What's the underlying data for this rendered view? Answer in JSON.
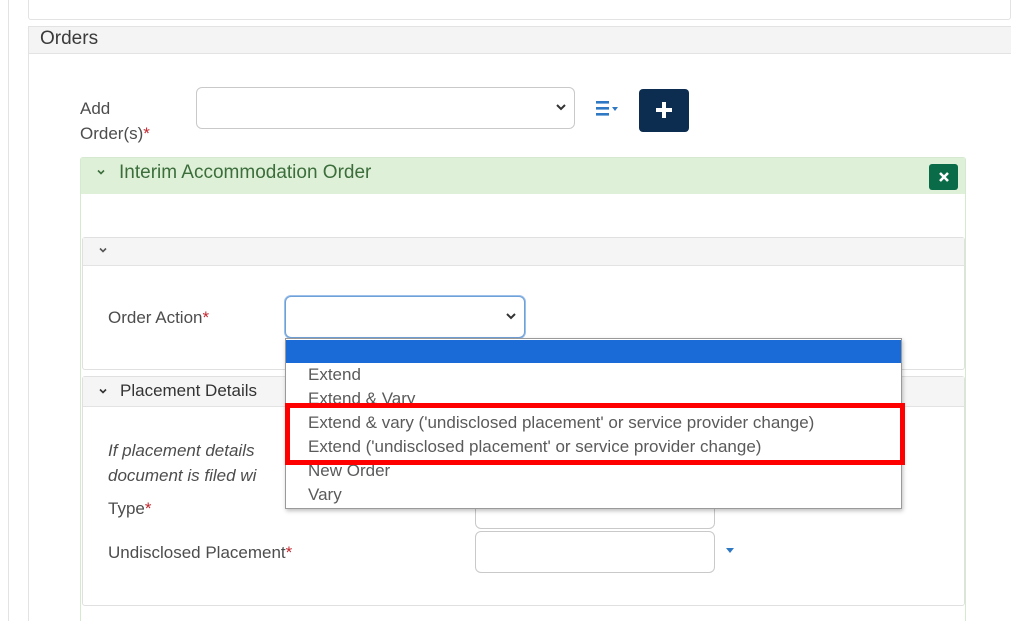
{
  "orders": {
    "title": "Orders",
    "add_label": "Add Order(s)",
    "required_mark": "*",
    "add_select_value": "",
    "add_button_icon": "plus-icon",
    "list_icon": "list-dropdown-icon"
  },
  "interim_order": {
    "title": "Interim Accommodation Order",
    "collapse_icon": "chevron-down-icon",
    "remove_icon": "close-icon"
  },
  "order_action": {
    "label": "Order Action",
    "value": "",
    "options": [
      "",
      "Extend",
      "Extend & Vary",
      "Extend & vary ('undisclosed placement' or service provider change)",
      "Extend ('undisclosed placement' or service provider change)",
      "New Order",
      "Vary"
    ],
    "selected_index": 0
  },
  "placement": {
    "title": "Placement Details",
    "info_line1": "If placement details",
    "info_line2": "document is filed wi",
    "type_label": "Type",
    "undisclosed_label": "Undisclosed Placement"
  },
  "colors": {
    "primary_button": "#0c2d4f",
    "success_header": "#dff0d8",
    "danger_button": "#0a6b48",
    "dropdown_highlight": "#1a6bd8",
    "annotation_red": "#ff0000",
    "required": "#c0262d"
  }
}
